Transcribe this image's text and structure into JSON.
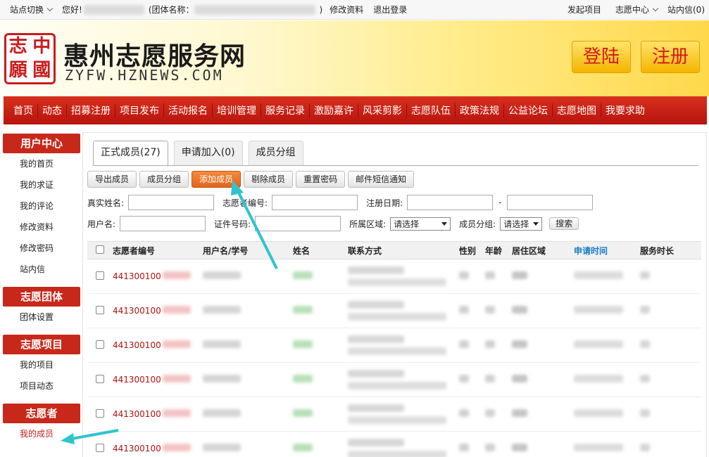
{
  "topbar": {
    "site_switch": "站点切换",
    "greeting": "您好!",
    "org_label": "团体名称：",
    "close_paren": ")",
    "edit_profile": "修改资料",
    "logout": "退出登录",
    "launch_project": "发起项目",
    "volunteer_center": "志愿中心",
    "inbox": "站内信(0)"
  },
  "header": {
    "seal_chars": [
      "中",
      "志",
      "國",
      "願"
    ],
    "site_name": "惠州志愿服务网",
    "site_url": "ZYFW.HZNEWS.COM",
    "login": "登陆",
    "register": "注册"
  },
  "nav": [
    "首页",
    "动态",
    "招募注册",
    "项目发布",
    "活动报名",
    "培训管理",
    "服务记录",
    "激励嘉许",
    "风采剪影",
    "志愿队伍",
    "政策法规",
    "公益论坛",
    "志愿地图",
    "我要求助"
  ],
  "sidebar": {
    "groups": [
      {
        "title": "用户中心",
        "items": [
          "我的首页",
          "我的求证",
          "我的评论",
          "修改资料",
          "修改密码",
          "站内信"
        ]
      },
      {
        "title": "志愿团体",
        "items": [
          "团体设置"
        ]
      },
      {
        "title": "志愿项目",
        "items": [
          "我的项目",
          "项目动态"
        ]
      },
      {
        "title": "志愿者",
        "items": [
          "我的成员"
        ]
      }
    ]
  },
  "tabs": [
    "正式成员(27)",
    "申请加入(0)",
    "成员分组"
  ],
  "toolbar": [
    "导出成员",
    "成员分组",
    "添加成员",
    "剔除成员",
    "重置密码",
    "邮件短信通知"
  ],
  "filters": {
    "real_name": "真实姓名:",
    "volunteer_no": "志愿者编号:",
    "reg_date": "注册日期:",
    "dash": "-",
    "username": "用户名:",
    "id_no": "证件号码:",
    "region": "所属区域:",
    "region_value": "请选择",
    "group": "成员分组:",
    "group_value": "请选择",
    "search": "搜索"
  },
  "table": {
    "headers": [
      "志愿者编号",
      "用户名/学号",
      "姓名",
      "联系方式",
      "性别",
      "年龄",
      "居住区域",
      "申请时间",
      "服务时长"
    ],
    "sort_color": "#1a7dc4",
    "rows": [
      {
        "id": "441300100"
      },
      {
        "id": "441300100"
      },
      {
        "id": "441300100"
      },
      {
        "id": "441300100"
      },
      {
        "id": "441300100"
      },
      {
        "id": "441300100"
      }
    ]
  },
  "colors": {
    "brand_red": "#c8281a",
    "annotation_arrow": "#2ec4cf",
    "add_button": "#e8701f"
  }
}
